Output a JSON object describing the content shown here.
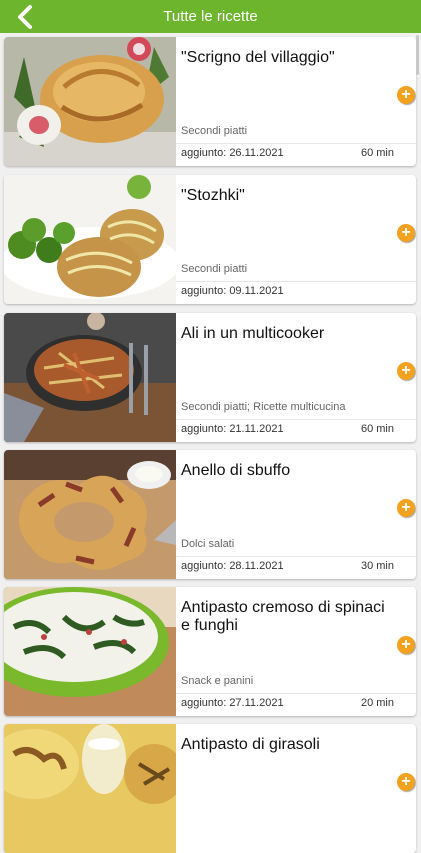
{
  "header": {
    "title": "Tutte le ricette",
    "back_icon": "chevron-left-icon",
    "bar_color": "#6cb52d"
  },
  "accent_color": "#f2a21f",
  "recipes": [
    {
      "name": "\"Scrigno del villaggio\"",
      "category": "Secondi piatti",
      "date": "aggiunto: 26.11.2021",
      "time": "60 min"
    },
    {
      "name": "\"Stozhki\"",
      "category": "Secondi piatti",
      "date": "aggiunto: 09.11.2021",
      "time": ""
    },
    {
      "name": "Ali in un multicooker",
      "category": "Secondi piatti; Ricette multicucina",
      "date": "aggiunto: 21.11.2021",
      "time": "60 min"
    },
    {
      "name": "Anello di sbuffo",
      "category": "Dolci salati",
      "date": "aggiunto: 28.11.2021",
      "time": "30 min"
    },
    {
      "name": "Antipasto cremoso di spinaci e funghi",
      "category": "Snack e panini",
      "date": "aggiunto: 27.11.2021",
      "time": "20 min"
    },
    {
      "name": "Antipasto di girasoli",
      "category": "",
      "date": "",
      "time": ""
    }
  ]
}
